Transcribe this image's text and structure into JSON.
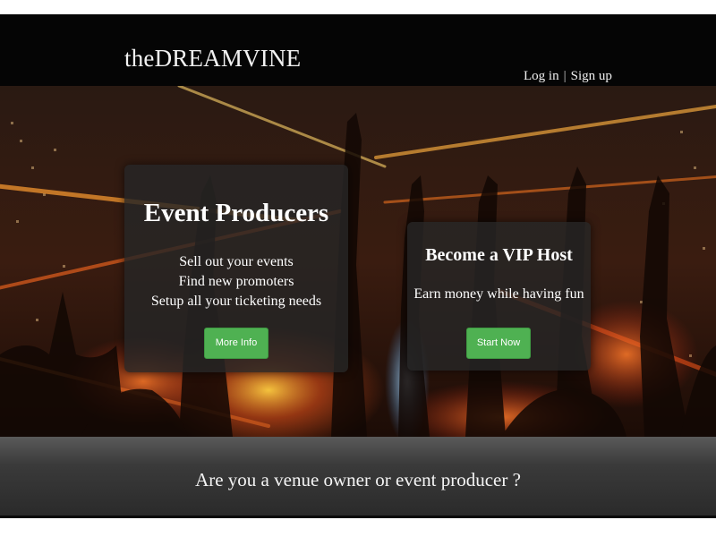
{
  "header": {
    "logo": "theDREAMVINE",
    "login_label": "Log in",
    "separator": "|",
    "signup_label": "Sign up"
  },
  "cards": {
    "producers": {
      "title": "Event Producers",
      "lines": [
        "Sell out your events",
        "Find new promoters",
        "Setup all your ticketing needs"
      ],
      "button_label": "More Info"
    },
    "vip": {
      "title": "Become a VIP Host",
      "subtitle": "Earn money while having fun",
      "button_label": "Start Now"
    }
  },
  "banner": {
    "text": "Are you a venue owner or event producer ?"
  },
  "colors": {
    "header_bg": "#050505",
    "button_green": "#4fb152",
    "card_bg": "rgba(38,38,38,0.82)",
    "banner_bg": "#3a3a3a"
  }
}
